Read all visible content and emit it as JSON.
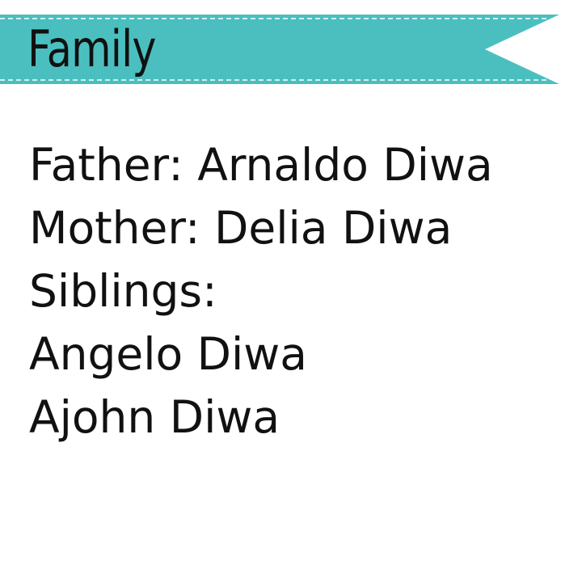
{
  "banner": {
    "title": "Family",
    "color": "#4bbfbf",
    "stitch_color": "#ffffff"
  },
  "family": {
    "father": "Father: Arnaldo Diwa",
    "mother": "Mother: Delia Diwa",
    "siblings_label": "Siblings:",
    "siblings": [
      "Angelo Diwa",
      "Ajohn Diwa"
    ]
  }
}
